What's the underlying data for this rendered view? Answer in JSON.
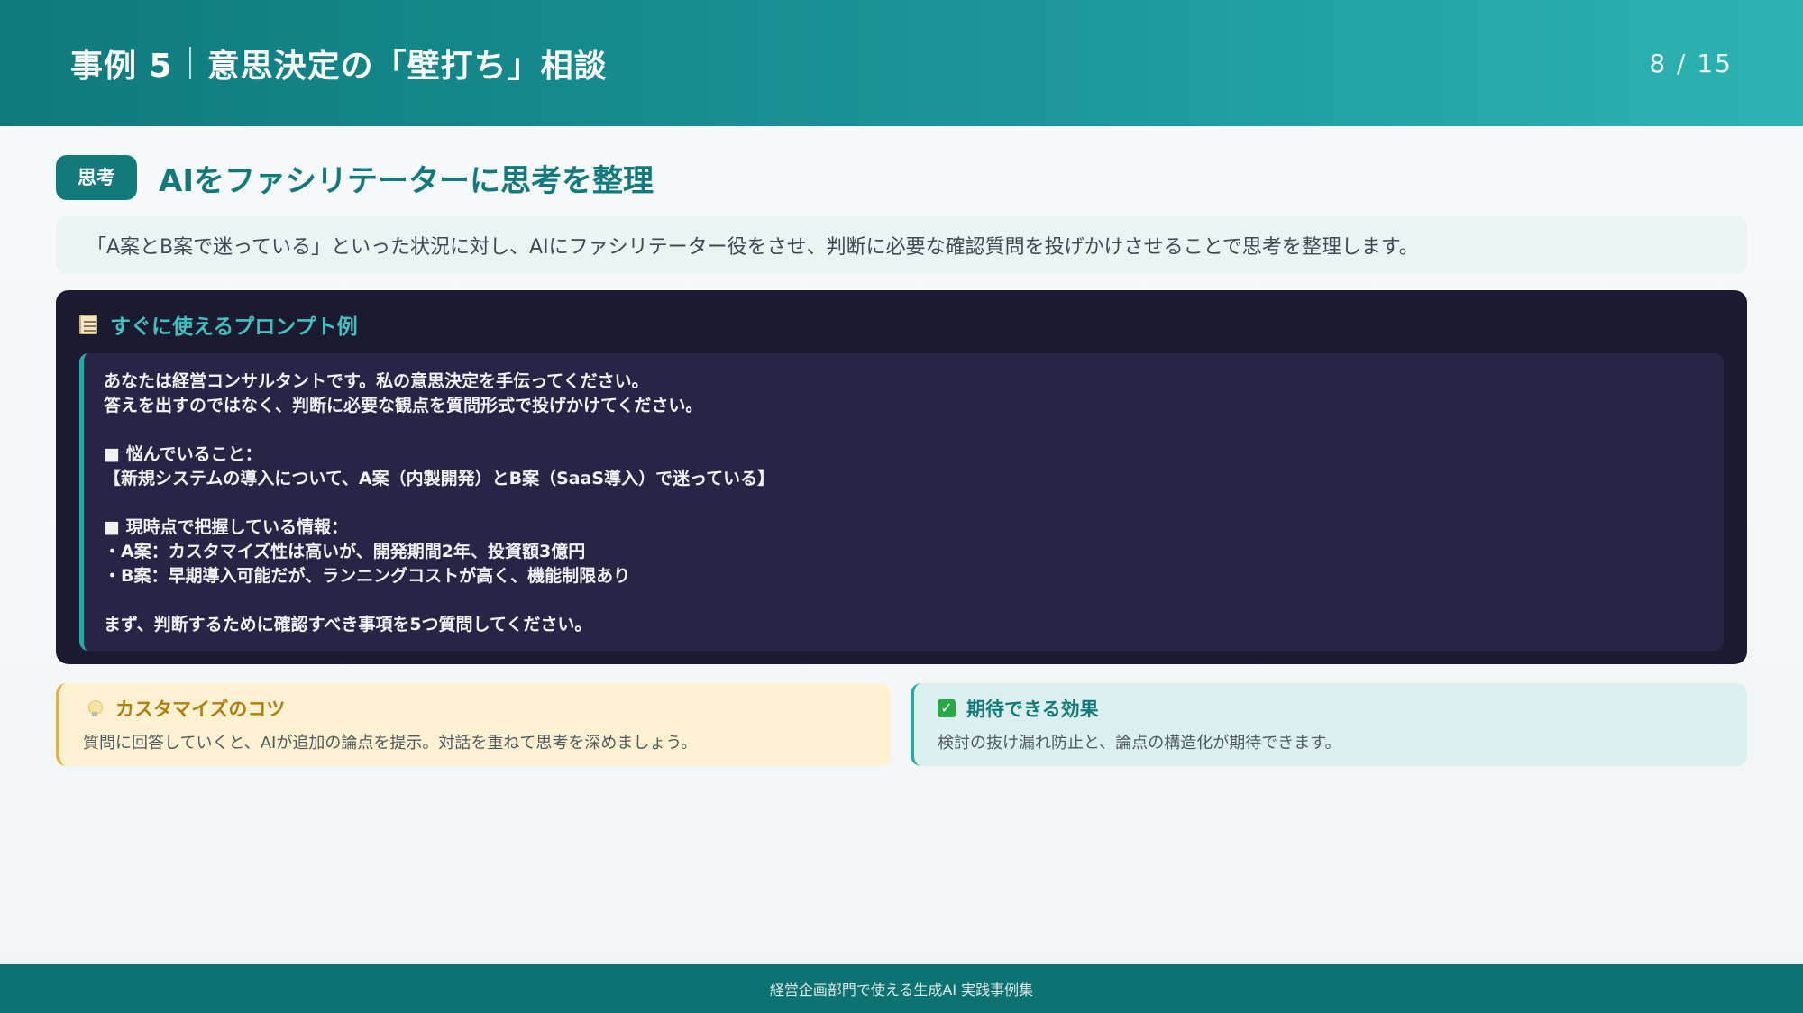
{
  "header": {
    "case_label": "事例 5",
    "title": "意思決定の「壁打ち」相談",
    "page": "8 / 15"
  },
  "section": {
    "tag": "思考",
    "title": "AIをファシリテーターに思考を整理"
  },
  "description": "「A案とB案で迷っている」といった状況に対し、AIにファシリテーター役をさせ、判断に必要な確認質問を投げかけさせることで思考を整理します。",
  "prompt": {
    "icon": "memo-icon",
    "label": "すぐに使えるプロンプト例",
    "lines": [
      "あなたは経営コンサルタントです。私の意思決定を手伝ってください。",
      "答えを出すのではなく、判断に必要な観点を質問形式で投げかけてください。",
      "",
      "■ 悩んでいること：",
      "【新規システムの導入について、A案（内製開発）とB案（SaaS導入）で迷っている】",
      "",
      "■ 現時点で把握している情報：",
      "・A案：カスタマイズ性は高いが、開発期間2年、投資額3億円",
      "・B案：早期導入可能だが、ランニングコストが高く、機能制限あり",
      "",
      "まず、判断するために確認すべき事項を5つ質問してください。"
    ]
  },
  "tips": {
    "customize": {
      "icon": "lightbulb-icon",
      "title": "カスタマイズのコツ",
      "text": "質問に回答していくと、AIが追加の論点を提示。対話を重ねて思考を深めましょう。"
    },
    "effect": {
      "icon": "check-icon",
      "title": "期待できる効果",
      "text": "検討の抜け漏れ防止と、論点の構造化が期待できます。"
    }
  },
  "footer": "経営企画部門で使える生成AI 実践事例集",
  "colors": {
    "primary": "#137a7c",
    "header_start": "#0f7a7c",
    "header_end": "#2db3b3",
    "prompt_bg": "#1b1a30",
    "prompt_accent": "#3fc1c0",
    "tip_yellow": "#fdf1d2",
    "tip_teal": "#dcefef"
  }
}
